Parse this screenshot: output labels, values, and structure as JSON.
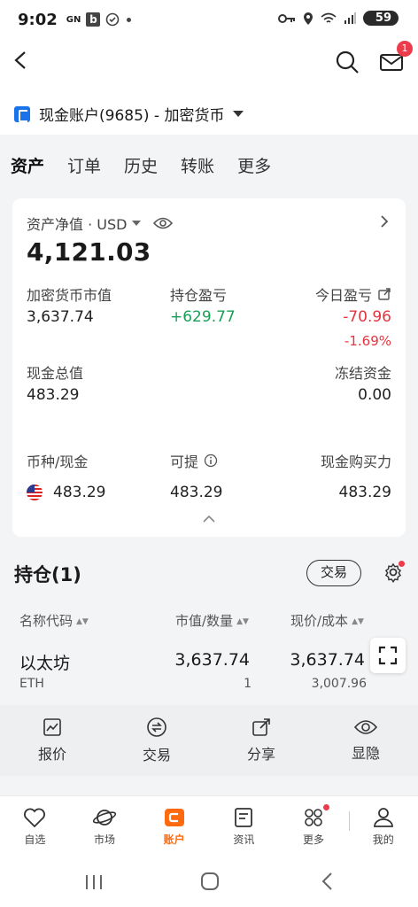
{
  "status_bar": {
    "time": "9:02",
    "carrier": "GN",
    "app_badge": "b",
    "battery": "59"
  },
  "header": {
    "account_label": "现金账户(9685) - 加密货币",
    "mail_badge": "1"
  },
  "tabs": [
    {
      "label": "资产",
      "active": true
    },
    {
      "label": "订单",
      "active": false
    },
    {
      "label": "历史",
      "active": false
    },
    {
      "label": "转账",
      "active": false
    },
    {
      "label": "更多",
      "active": false
    }
  ],
  "assets": {
    "net_value_label": "资产净值 · USD",
    "net_value": "4,121.03",
    "crypto_market_value_label": "加密货币市值",
    "crypto_market_value": "3,637.74",
    "position_pl_label": "持仓盈亏",
    "position_pl": "+629.77",
    "today_pl_label": "今日盈亏",
    "today_pl": "-70.96",
    "today_pl_pct": "-1.69%",
    "total_cash_label": "现金总值",
    "total_cash": "483.29",
    "frozen_label": "冻结资金",
    "frozen": "0.00",
    "currency_cash_label": "币种/现金",
    "withdrawable_label": "可提",
    "buying_power_label": "现金购买力",
    "usd_cash": "483.29",
    "withdrawable": "483.29",
    "buying_power": "483.29"
  },
  "holdings": {
    "title": "持仓(1)",
    "trade_button": "交易",
    "columns": [
      "名称代码",
      "市值/数量",
      "现价/成本"
    ],
    "rows": [
      {
        "name": "以太坊",
        "code": "ETH",
        "market_value": "3,637.74",
        "quantity": "1",
        "price": "3,637.74",
        "cost": "3,007.96"
      }
    ]
  },
  "actions": [
    {
      "label": "报价",
      "icon": "chart-icon"
    },
    {
      "label": "交易",
      "icon": "trade-icon"
    },
    {
      "label": "分享",
      "icon": "share-icon"
    },
    {
      "label": "显隐",
      "icon": "eye-icon"
    }
  ],
  "nav": [
    {
      "label": "自选",
      "icon": "heart-icon"
    },
    {
      "label": "市场",
      "icon": "planet-icon"
    },
    {
      "label": "账户",
      "icon": "account-icon",
      "active": true
    },
    {
      "label": "资讯",
      "icon": "news-icon"
    },
    {
      "label": "更多",
      "icon": "grid-icon"
    },
    {
      "label": "我的",
      "icon": "person-icon"
    }
  ],
  "colors": {
    "accent": "#ff6a10",
    "gain": "#18a058",
    "loss": "#e5343f",
    "badge": "#ec3b4a"
  }
}
